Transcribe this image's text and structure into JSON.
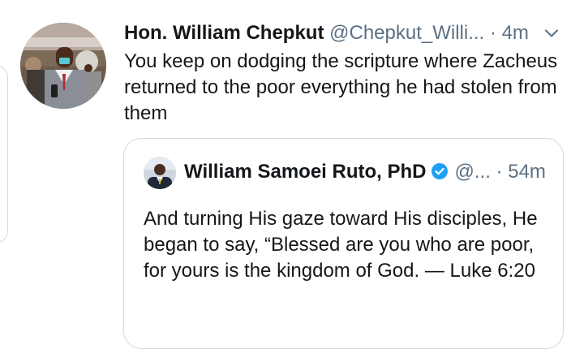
{
  "tweet": {
    "author_name": "Hon. William Chepkut",
    "handle": "@Chepkut_Willi...",
    "separator": "·",
    "time": "4m",
    "avatar_icon": "person-speaking-avatar",
    "menu_icon": "chevron-down-icon",
    "text": "You keep on dodging the scripture where Zacheus returned to the poor everything he had stolen from them"
  },
  "quoted_tweet": {
    "author_name": "William Samoei Ruto, PhD",
    "verified_icon": "verified-badge-icon",
    "handle": "@...",
    "separator": "·",
    "time": "54m",
    "text": "And turning His gaze toward His disciples, He began to say, “Blessed are you who are poor, for yours is the kingdom of God. — Luke 6:20"
  },
  "colors": {
    "text_primary": "#14171a",
    "text_secondary": "#5b7083",
    "border": "#cfd9de",
    "verified_blue": "#1da1f2"
  }
}
